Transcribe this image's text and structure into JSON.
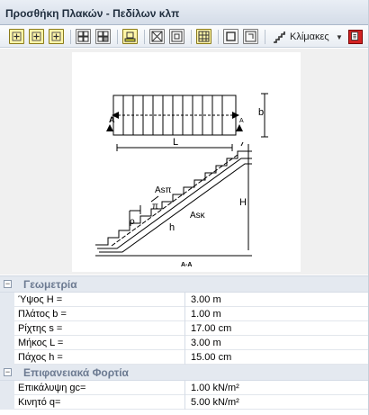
{
  "window": {
    "title": "Προσθήκη Πλακών - Πεδίλων κλπ"
  },
  "toolbar": {
    "buttons": [
      "add-slab-icon",
      "add-slab-alt-icon",
      "add-slab-third-icon",
      "grid-slab-icon",
      "grid-slab-alt-icon",
      "footing-icon",
      "cross-slab-icon",
      "cross-slab-alt-icon",
      "grid-table-icon",
      "square-icon",
      "frame-icon"
    ],
    "stairs_label": "Κλίμακες",
    "stairs_icon": "stairs-icon",
    "close_icon": "red-close-icon"
  },
  "drawing": {
    "labels": {
      "section_a_left": "A",
      "section_a_right": "A",
      "width_b": "b",
      "length_L": "L",
      "Asp": "Asπ",
      "Ask": "Asκ",
      "pi": "π",
      "rho": "ρ",
      "thickness_h": "h",
      "height_H": "H",
      "section_caption": "A-A"
    }
  },
  "properties": {
    "geometry": {
      "title": "Γεωμετρία",
      "toggle": "−",
      "rows": [
        {
          "name": "Ύψος H =",
          "value": "3.00 m"
        },
        {
          "name": "Πλάτος b =",
          "value": "1.00 m"
        },
        {
          "name": "Ρίχτης s =",
          "value": "17.00 cm"
        },
        {
          "name": "Μήκος L =",
          "value": "3.00 m"
        },
        {
          "name": "Πάχος h =",
          "value": "15.00 cm"
        }
      ]
    },
    "loads": {
      "title": "Επιφανειακά Φορτία",
      "toggle": "−",
      "rows": [
        {
          "name": "Επικάλυψη gc=",
          "value": "1.00 kN/m²"
        },
        {
          "name": "Κινητό q=",
          "value": "5.00 kN/m²"
        }
      ]
    }
  }
}
